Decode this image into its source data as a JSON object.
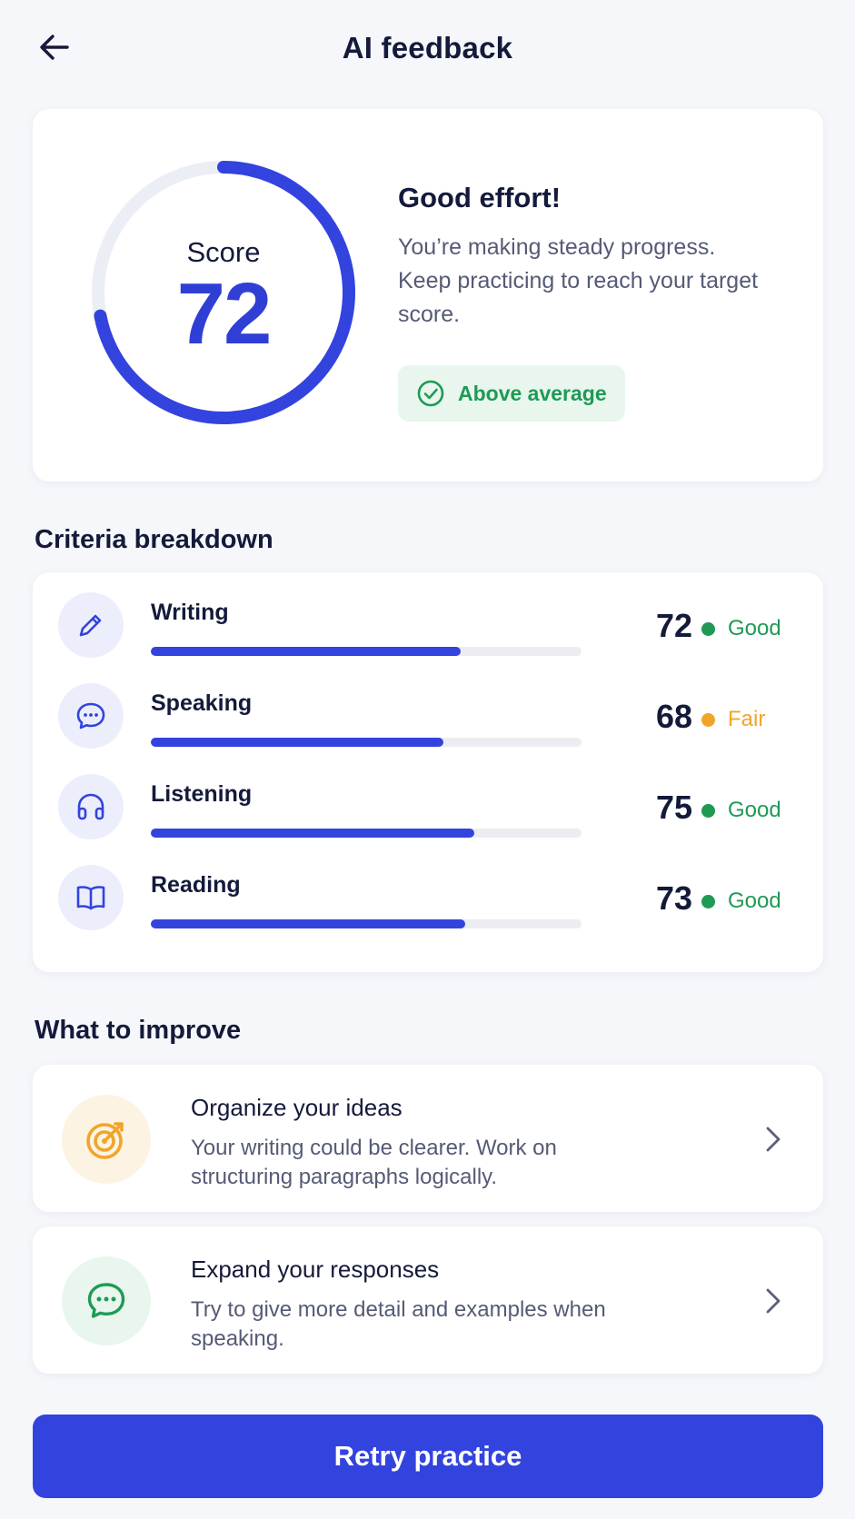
{
  "header": {
    "title": "AI feedback",
    "back_icon": "arrow-left-icon"
  },
  "score_card": {
    "label": "Score",
    "value": "72",
    "progress_percent": 72,
    "heading": "Good effort!",
    "message": "You’re making steady progress. Keep practicing to reach your target score.",
    "badge": {
      "icon": "check-circle-icon",
      "label": "Above average"
    }
  },
  "criteria": {
    "title": "Criteria breakdown",
    "items": [
      {
        "name": "Writing",
        "score": "72",
        "value": 72,
        "status": "Good",
        "icon": "pencil-icon",
        "status_color": "#1f9a55"
      },
      {
        "name": "Speaking",
        "score": "68",
        "value": 68,
        "status": "Fair",
        "icon": "chat-bubble-icon",
        "status_color": "#f0a52a"
      },
      {
        "name": "Listening",
        "score": "75",
        "value": 75,
        "status": "Good",
        "icon": "headphones-icon",
        "status_color": "#1f9a55"
      },
      {
        "name": "Reading",
        "score": "73",
        "value": 73,
        "status": "Good",
        "icon": "book-open-icon",
        "status_color": "#1f9a55"
      }
    ]
  },
  "improve": {
    "title": "What to improve",
    "items": [
      {
        "title": "Organize your ideas",
        "text": "Your writing could be clearer. Work on structuring paragraphs logically.",
        "icon": "target-icon"
      },
      {
        "title": "Expand your responses",
        "text": "Try to give more detail and examples when speaking.",
        "icon": "chat-dots-icon"
      }
    ]
  },
  "retry_button": {
    "label": "Retry practice"
  },
  "colors": {
    "accent": "#3343de",
    "good": "#1f9a55",
    "fair": "#f0a52a",
    "background": "#f6f7fb"
  }
}
